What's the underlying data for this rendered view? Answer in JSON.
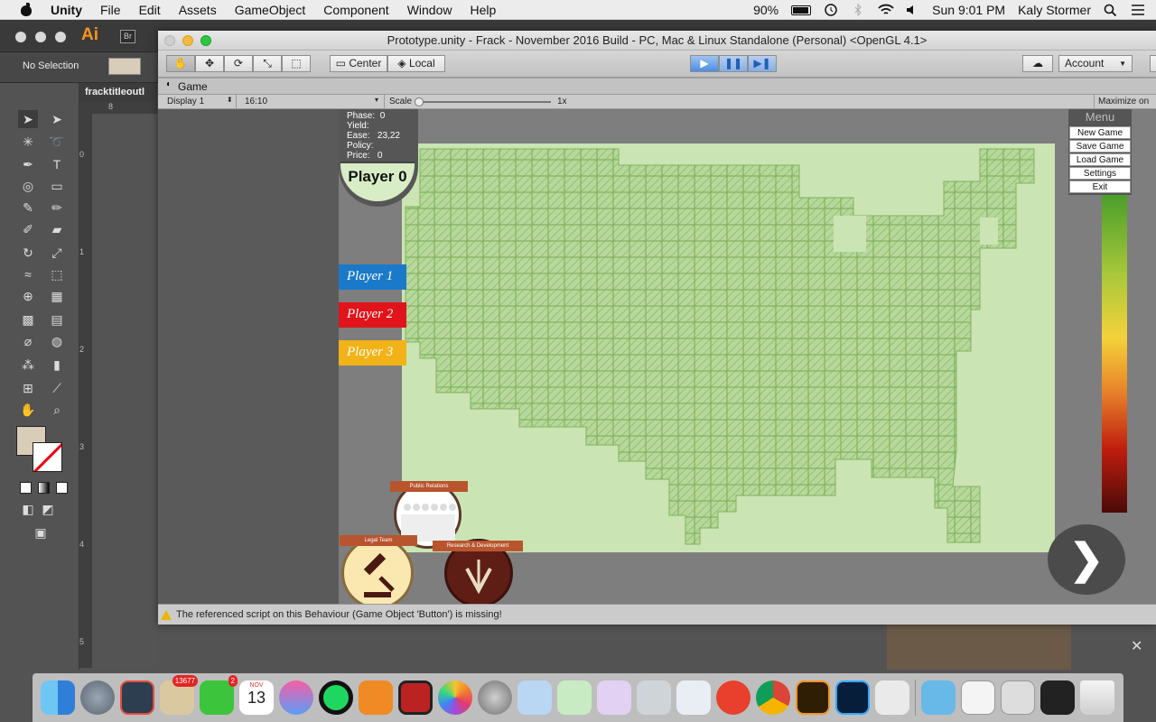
{
  "menubar": {
    "app": "Unity",
    "items": [
      "File",
      "Edit",
      "Assets",
      "GameObject",
      "Component",
      "Window",
      "Help"
    ],
    "battery": "90%",
    "clock": "Sun 9:01 PM",
    "user": "Kaly Stormer"
  },
  "illustrator": {
    "logo": "Ai",
    "bridge": "Br",
    "no_selection": "No Selection",
    "doc_tab": "fracktitleoutl",
    "ruler_h": "8",
    "ruler_v": [
      "0",
      "1",
      "2",
      "3",
      "4",
      "5"
    ]
  },
  "unity": {
    "title": "Prototype.unity - Frack - November 2016 Build - PC, Mac & Linux Standalone (Personal) <OpenGL 4.1>",
    "pivot": "Center",
    "space": "Local",
    "account": "Account",
    "game_tab": "Game",
    "display": "Display 1",
    "aspect": "16:10",
    "scale_label": "Scale",
    "scale_value": "1x",
    "maximize": "Maximize on",
    "status": "The referenced script on this Behaviour (Game Object 'Button') is missing!"
  },
  "game": {
    "stats": [
      {
        "label": "Phase:",
        "value": "0"
      },
      {
        "label": "Yield:",
        "value": ""
      },
      {
        "label": "Ease:",
        "value": "23,22"
      },
      {
        "label": "Policy:",
        "value": ""
      },
      {
        "label": "Price:",
        "value": "0"
      }
    ],
    "current_player": "Player 0",
    "players": [
      {
        "name": "Player 1",
        "color": "#1a7ac9"
      },
      {
        "name": "Player 2",
        "color": "#e0141a"
      },
      {
        "name": "Player 3",
        "color": "#f2b318"
      }
    ],
    "menu": {
      "title": "Menu",
      "items": [
        "New Game",
        "Save Game",
        "Load Game",
        "Settings",
        "Exit"
      ]
    },
    "departments": [
      {
        "name": "Public Relations"
      },
      {
        "name": "Legal Team"
      },
      {
        "name": "Research & Development"
      }
    ],
    "next_label": "❯"
  },
  "dock": {
    "badges": {
      "mail": "13677",
      "facetime": "2"
    },
    "calendar_month": "NOV",
    "calendar_day": "13"
  },
  "colors": {
    "map_bg": "#cbe4b4",
    "tile": "#7fb35a"
  }
}
